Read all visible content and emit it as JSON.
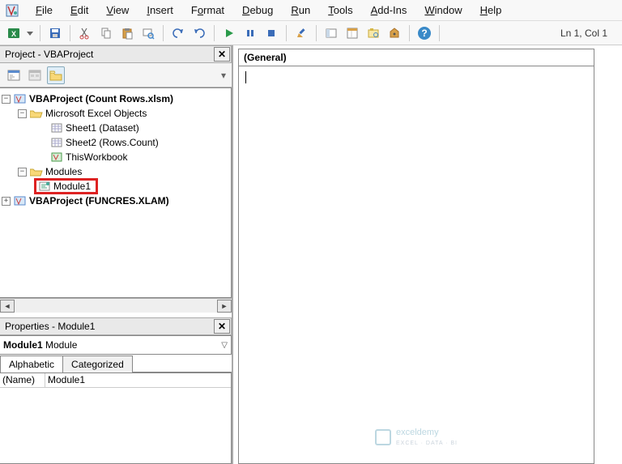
{
  "menu": {
    "file": "File",
    "edit": "Edit",
    "view": "View",
    "insert": "Insert",
    "format": "Format",
    "debug": "Debug",
    "run": "Run",
    "tools": "Tools",
    "addins": "Add-Ins",
    "window": "Window",
    "help": "Help"
  },
  "status": {
    "position": "Ln 1, Col 1"
  },
  "project_pane": {
    "title": "Project - VBAProject",
    "root1": "VBAProject (Count Rows.xlsm)",
    "folder1": "Microsoft Excel Objects",
    "sheet1": "Sheet1 (Dataset)",
    "sheet2": "Sheet2 (Rows.Count)",
    "thiswb": "ThisWorkbook",
    "modules_folder": "Modules",
    "module1": "Module1",
    "root2": "VBAProject (FUNCRES.XLAM)"
  },
  "properties_pane": {
    "title": "Properties - Module1",
    "object_label": "Module1",
    "object_type": "Module",
    "tab_alpha": "Alphabetic",
    "tab_cat": "Categorized",
    "prop_name_key": "(Name)",
    "prop_name_val": "Module1"
  },
  "code_pane": {
    "object_dropdown": "(General)"
  },
  "watermark": {
    "brand": "exceldemy",
    "tag": "EXCEL · DATA · BI"
  }
}
